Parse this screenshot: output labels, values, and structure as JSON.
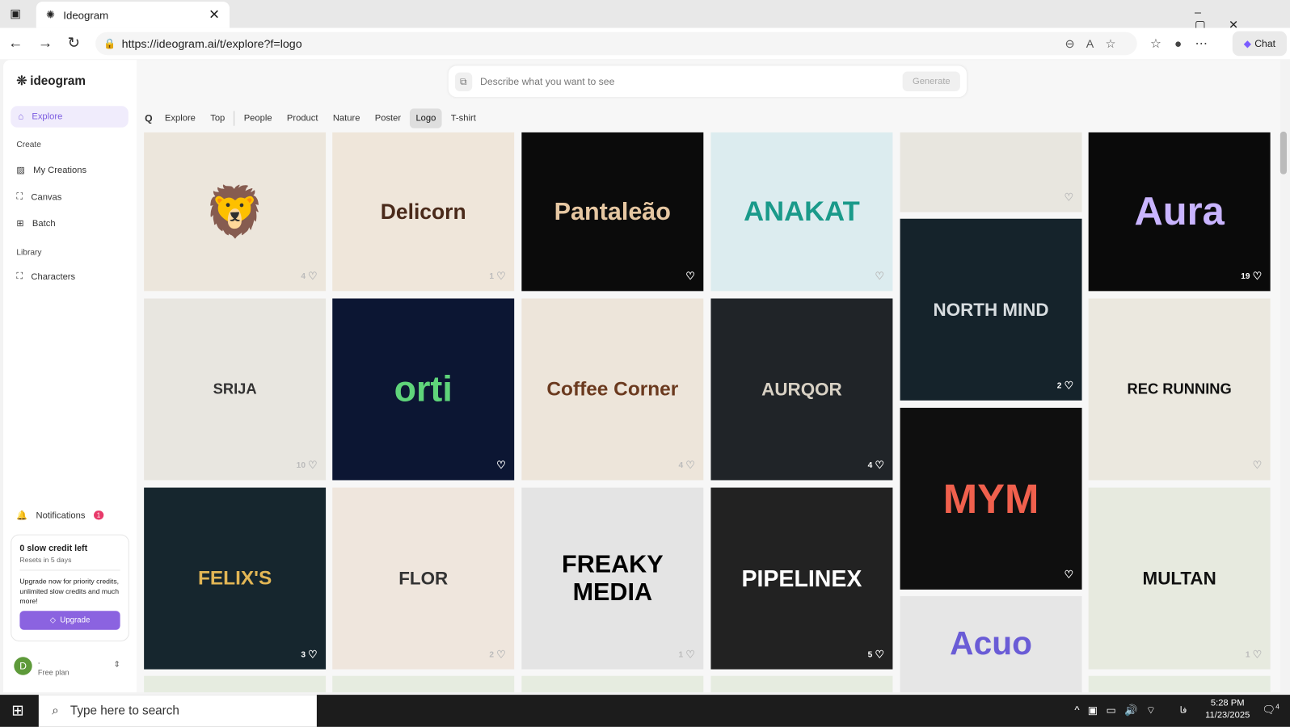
{
  "browser": {
    "tab_title": "Ideogram",
    "url": "https://ideogram.ai/t/explore?f=logo",
    "chat": "Chat"
  },
  "sidebar": {
    "brand": "ideogram",
    "explore": "Explore",
    "create_heading": "Create",
    "create": [
      "My Creations",
      "Canvas",
      "Batch"
    ],
    "library_heading": "Library",
    "library": [
      "Characters"
    ],
    "notifications": "Notifications",
    "notif_count": "1",
    "credits": {
      "title": "0 slow credit left",
      "reset": "Resets in 5 days",
      "pitch": "Upgrade now for priority credits, unlimited slow credits and much more!",
      "button": "Upgrade"
    },
    "user": {
      "initial": "D",
      "name": ".",
      "plan": "Free plan"
    }
  },
  "prompt": {
    "placeholder": "Describe what you want to see",
    "generate": "Generate"
  },
  "filters": [
    "Explore",
    "Top",
    "People",
    "Product",
    "Nature",
    "Poster",
    "Logo",
    "T-shirt"
  ],
  "active_filter": "Logo",
  "tiles": [
    {
      "logo": "🦁",
      "likes": "4",
      "bg": "#ece6dc",
      "fg": "#c33"
    },
    {
      "logo": "Delicorn",
      "likes": "1",
      "bg": "#efe6da",
      "fg": "#4a2a1a"
    },
    {
      "logo": "Pantaleão",
      "likes": "",
      "bg": "#0b0b0b",
      "fg": "#e6c7a2"
    },
    {
      "logo": "ANAKAT",
      "likes": "",
      "bg": "#dcecef",
      "fg": "#1a9a8a"
    },
    {
      "logo": "",
      "likes": "",
      "bg": "#e8e6df",
      "fg": "#999"
    },
    {
      "logo": "Aura",
      "likes": "19",
      "bg": "#0a0a0a",
      "fg": "#c9b4ff"
    },
    {
      "logo": "SRIJA",
      "likes": "10",
      "bg": "#e8e6e0",
      "fg": "#333"
    },
    {
      "logo": "orti",
      "likes": "",
      "bg": "#0c1633",
      "fg": "#5fd47a"
    },
    {
      "logo": "Coffee Corner",
      "likes": "4",
      "bg": "#ede5da",
      "fg": "#6b3a1f"
    },
    {
      "logo": "AURQOR",
      "likes": "4",
      "bg": "#202428",
      "fg": "#d8d1c4"
    },
    {
      "logo": "NORTH MIND",
      "likes": "2",
      "bg": "#15232b",
      "fg": "#d8dde0"
    },
    {
      "logo": "REC RUNNING",
      "likes": "",
      "bg": "#ebe8df",
      "fg": "#111"
    },
    {
      "logo": "FELIX'S",
      "likes": "3",
      "bg": "#16262e",
      "fg": "#e2b655"
    },
    {
      "logo": "FLOR",
      "likes": "2",
      "bg": "#efe6dd",
      "fg": "#333"
    },
    {
      "logo": "FREAKY MEDIA",
      "likes": "1",
      "bg": "#e4e4e4",
      "fg": "#000"
    },
    {
      "logo": "PIPELINEX",
      "likes": "5",
      "bg": "#222222",
      "fg": "#fff"
    },
    {
      "logo": "MYM",
      "likes": "",
      "bg": "#0f0f0f",
      "fg": "#f0604d"
    },
    {
      "logo": "MULTAN",
      "likes": "1",
      "bg": "#e7eadf",
      "fg": "#111"
    },
    {
      "logo": "Acuo",
      "likes": "",
      "bg": "#e6e6e6",
      "fg": "#6a5cd6"
    }
  ],
  "taskbar": {
    "search": "Type here to search",
    "time": "5:28 PM",
    "date": "11/23/2025",
    "lang": "فا",
    "notif": "4"
  }
}
